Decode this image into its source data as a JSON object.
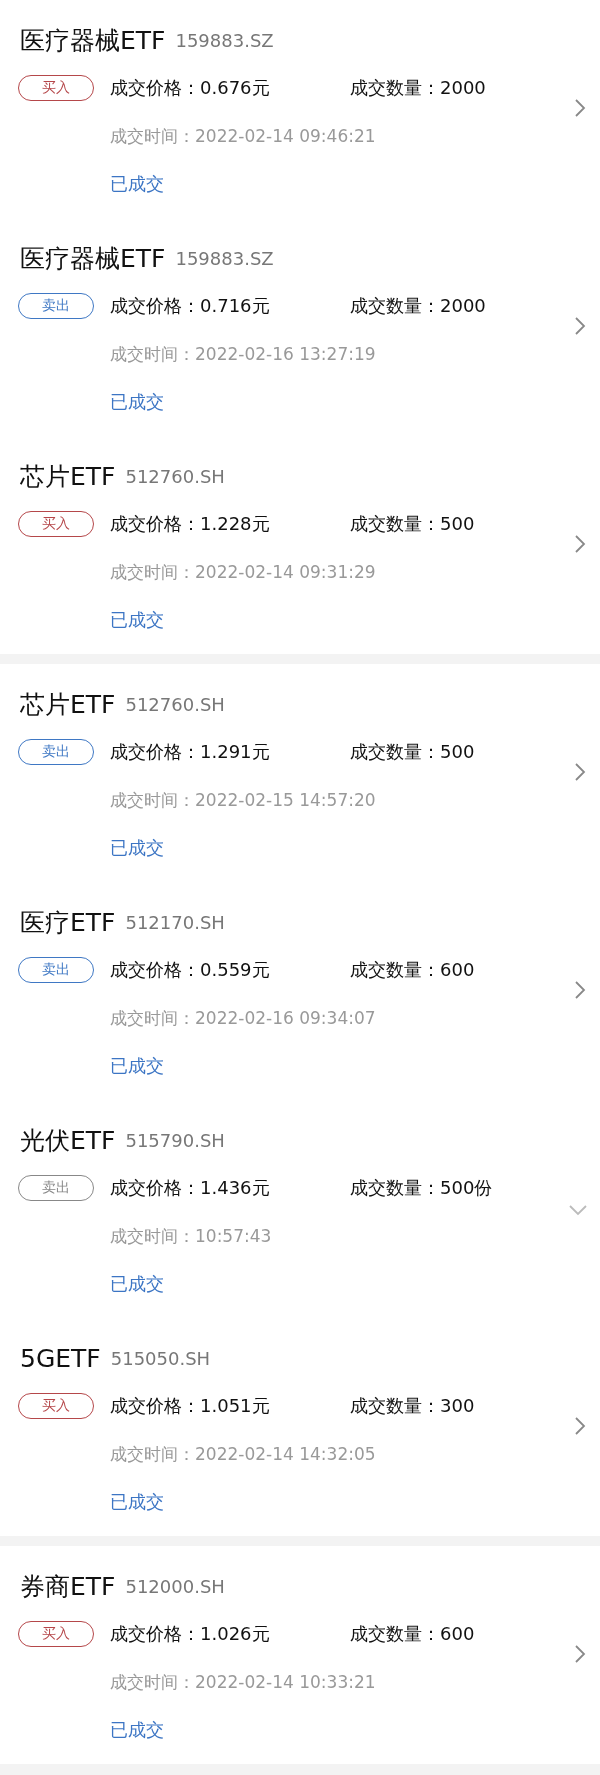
{
  "groups": [
    {
      "trades": [
        {
          "name": "医疗器械ETF",
          "code": "159883.SZ",
          "side": {
            "label": "买入",
            "color": "#b5474a"
          },
          "price": "成交价格：0.676元",
          "quantity": "成交数量：2000",
          "time": "成交时间：2022-02-14 09:46:21",
          "status": "已成交",
          "expanded": false
        },
        {
          "name": "医疗器械ETF",
          "code": "159883.SZ",
          "side": {
            "label": "卖出",
            "color": "#3f78c4"
          },
          "price": "成交价格：0.716元",
          "quantity": "成交数量：2000",
          "time": "成交时间：2022-02-16 13:27:19",
          "status": "已成交",
          "expanded": false
        },
        {
          "name": "芯片ETF",
          "code": "512760.SH",
          "side": {
            "label": "买入",
            "color": "#b5474a"
          },
          "price": "成交价格：1.228元",
          "quantity": "成交数量：500",
          "time": "成交时间：2022-02-14 09:31:29",
          "status": "已成交",
          "expanded": false
        }
      ]
    },
    {
      "trades": [
        {
          "name": "芯片ETF",
          "code": "512760.SH",
          "side": {
            "label": "卖出",
            "color": "#3f78c4"
          },
          "price": "成交价格：1.291元",
          "quantity": "成交数量：500",
          "time": "成交时间：2022-02-15 14:57:20",
          "status": "已成交",
          "expanded": false
        },
        {
          "name": "医疗ETF",
          "code": "512170.SH",
          "side": {
            "label": "卖出",
            "color": "#3f78c4"
          },
          "price": "成交价格：0.559元",
          "quantity": "成交数量：600",
          "time": "成交时间：2022-02-16 09:34:07",
          "status": "已成交",
          "expanded": false
        },
        {
          "name": "光伏ETF",
          "code": "515790.SH",
          "side": {
            "label": "卖出",
            "color": "#888888"
          },
          "price": "成交价格：1.436元",
          "quantity": "成交数量：500份",
          "time": "成交时间：10:57:43",
          "status": "已成交",
          "expanded": true
        },
        {
          "name": "5GETF",
          "code": "515050.SH",
          "side": {
            "label": "买入",
            "color": "#b5474a"
          },
          "price": "成交价格：1.051元",
          "quantity": "成交数量：300",
          "time": "成交时间：2022-02-14 14:32:05",
          "status": "已成交",
          "expanded": false
        }
      ]
    },
    {
      "trades": [
        {
          "name": "券商ETF",
          "code": "512000.SH",
          "side": {
            "label": "买入",
            "color": "#b5474a"
          },
          "price": "成交价格：1.026元",
          "quantity": "成交数量：600",
          "time": "成交时间：2022-02-14 10:33:21",
          "status": "已成交",
          "expanded": false
        }
      ]
    }
  ]
}
